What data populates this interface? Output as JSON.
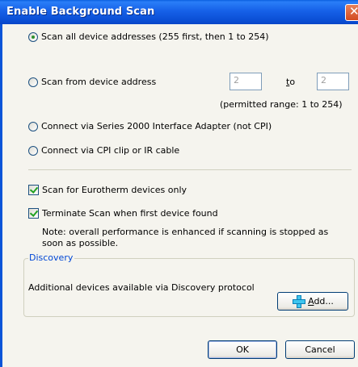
{
  "window": {
    "title": "Enable Background Scan",
    "close_glyph": "✕"
  },
  "scan_options": {
    "scan_all": "Scan all device addresses (255 first, then 1 to 254)",
    "scan_from": "Scan from device address",
    "from_value": "2",
    "to_label_pre": "",
    "to_label_u": "t",
    "to_label_post": "o",
    "to_value": "2",
    "range_note": "(permitted range: 1 to 254)",
    "series2000": "Connect via Series 2000 Interface Adapter (not CPI)",
    "cpi": "Connect via CPI clip or IR cable",
    "selected": "scan_all"
  },
  "checks": {
    "eurotherm_only": "Scan for Eurotherm devices only",
    "eurotherm_checked": true,
    "terminate": "Terminate Scan when first device found",
    "terminate_checked": true,
    "note_line1": "Note: overall performance is enhanced if scanning is stopped as",
    "note_line2": "soon as possible."
  },
  "discovery": {
    "group_label": "Discovery",
    "text": "Additional devices available via Discovery protocol",
    "add_u": "A",
    "add_rest": "dd..."
  },
  "buttons": {
    "ok": "OK",
    "cancel": "Cancel"
  },
  "colors": {
    "titlebar": "#0a4ed4",
    "group_label": "#0046d5",
    "check_mark": "#21a121"
  }
}
